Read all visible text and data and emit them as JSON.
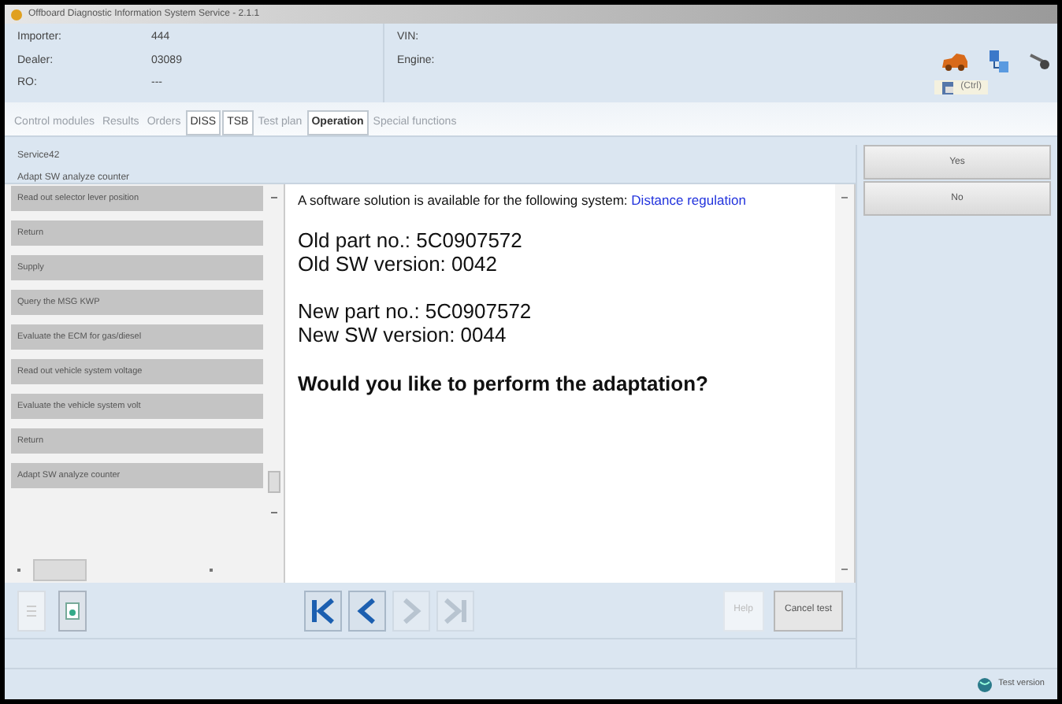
{
  "window": {
    "title": "Offboard Diagnostic Information System Service - 2.1.1"
  },
  "info": [
    {
      "label": "Importer:",
      "value": "444"
    },
    {
      "label": "Dealer:",
      "value": "03089"
    },
    {
      "label": "RO:",
      "value": "---"
    }
  ],
  "vehicle": [
    {
      "label": "VIN:"
    },
    {
      "label": "Engine:"
    }
  ],
  "clipboard": {
    "label": "(Ctrl)"
  },
  "tabs": [
    {
      "label": "Control modules",
      "disabled": true,
      "selected": false
    },
    {
      "label": "Results",
      "disabled": true,
      "selected": false
    },
    {
      "label": "Orders",
      "disabled": true,
      "selected": false
    },
    {
      "label": "DISS",
      "disabled": false,
      "selected": false
    },
    {
      "label": "TSB",
      "disabled": false,
      "selected": false
    },
    {
      "label": "Test plan",
      "disabled": true,
      "selected": false
    },
    {
      "label": "Operation",
      "disabled": false,
      "selected": true
    },
    {
      "label": "Special functions",
      "disabled": true,
      "selected": false
    }
  ],
  "breadcrumb": [
    "Service42",
    "Adapt SW analyze counter"
  ],
  "steps": [
    {
      "label": "Read out selector lever position"
    },
    {
      "label": "Return"
    },
    {
      "label": "Supply"
    },
    {
      "label": "Query the MSG KWP"
    },
    {
      "label": "Evaluate the ECM for gas/diesel"
    },
    {
      "label": "Read out vehicle system voltage"
    },
    {
      "label": "Evaluate the vehicle system volt"
    },
    {
      "label": "Return"
    },
    {
      "label": "Adapt SW analyze counter"
    }
  ],
  "message": {
    "intro": "A software solution is available for the following system:",
    "link": "Distance regulation",
    "old_part": "Old part no.:  5C0907572",
    "old_sw": "Old SW version:  0042",
    "new_part": "New part no.:  5C0907572",
    "new_sw": "New SW version:  0044",
    "question": "Would you like to perform the adaptation?"
  },
  "answers": [
    "Yes",
    "No"
  ],
  "nav": [
    {
      "kind": "first",
      "disabled": false
    },
    {
      "kind": "prev",
      "disabled": false
    },
    {
      "kind": "next",
      "disabled": true
    },
    {
      "kind": "last",
      "disabled": true
    }
  ],
  "actions": [
    {
      "label": "Help",
      "disabled": true
    },
    {
      "label": "Cancel test",
      "disabled": false
    }
  ],
  "status_bar": {
    "text": "Test version"
  }
}
